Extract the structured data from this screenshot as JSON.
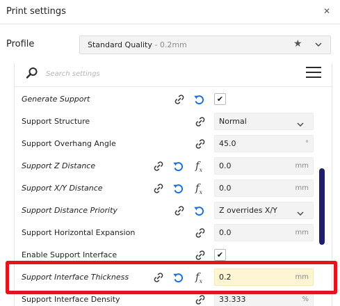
{
  "window": {
    "title": "Print settings",
    "close_glyph": "✕"
  },
  "profile": {
    "label": "Profile",
    "name": "Standard Quality",
    "suffix": " - 0.2mm",
    "favorite_icon": "star-icon",
    "dropdown_icon": "chevron-down-icon"
  },
  "search": {
    "placeholder": "Search settings",
    "value": "",
    "icon": "search-icon",
    "menu_icon": "hamburger-menu-icon"
  },
  "colors": {
    "reset_blue": "#1f6fd6",
    "scroll_thumb": "#1e1e6b",
    "highlight_field": "#fdf5d3",
    "annotation_red": "#e2141d"
  },
  "settings": [
    {
      "label": "Generate Support",
      "italic": true,
      "control": "checkbox",
      "checked": true,
      "check_glyph": "✔",
      "icons": [
        "link-icon",
        "reset-icon"
      ]
    },
    {
      "label": "Support Structure",
      "italic": false,
      "control": "select",
      "value": "Normal",
      "icons": [
        "link-icon"
      ]
    },
    {
      "label": "Support Overhang Angle",
      "italic": false,
      "control": "text",
      "value": "45.0",
      "unit": "°",
      "icons": [
        "link-icon"
      ]
    },
    {
      "label": "Support Z Distance",
      "italic": true,
      "control": "text",
      "value": "0.0",
      "unit": "mm",
      "icons": [
        "link-icon",
        "reset-icon",
        "formula-icon"
      ]
    },
    {
      "label": "Support X/Y Distance",
      "italic": true,
      "control": "text",
      "value": "0.0",
      "unit": "mm",
      "icons": [
        "link-icon",
        "reset-icon",
        "formula-icon"
      ]
    },
    {
      "label": "Support Distance Priority",
      "italic": true,
      "control": "select",
      "value": "Z overrides X/Y",
      "icons": [
        "link-icon",
        "reset-icon"
      ]
    },
    {
      "label": "Support Horizontal Expansion",
      "italic": false,
      "control": "text",
      "value": "0.0",
      "unit": "mm",
      "icons": [
        "link-icon"
      ]
    },
    {
      "label": "Enable Support Interface",
      "italic": false,
      "control": "checkbox",
      "checked": true,
      "check_glyph": "✔",
      "icons": [
        "link-icon"
      ]
    },
    {
      "label": "Support Interface Thickness",
      "italic": true,
      "control": "text",
      "value": "0.2",
      "unit": "mm",
      "highlighted": true,
      "icons": [
        "link-icon",
        "reset-icon",
        "formula-icon"
      ]
    },
    {
      "label": "Support Interface Density",
      "italic": false,
      "control": "text",
      "value": "33.333",
      "unit": "%",
      "icons": [
        "link-icon"
      ]
    }
  ]
}
